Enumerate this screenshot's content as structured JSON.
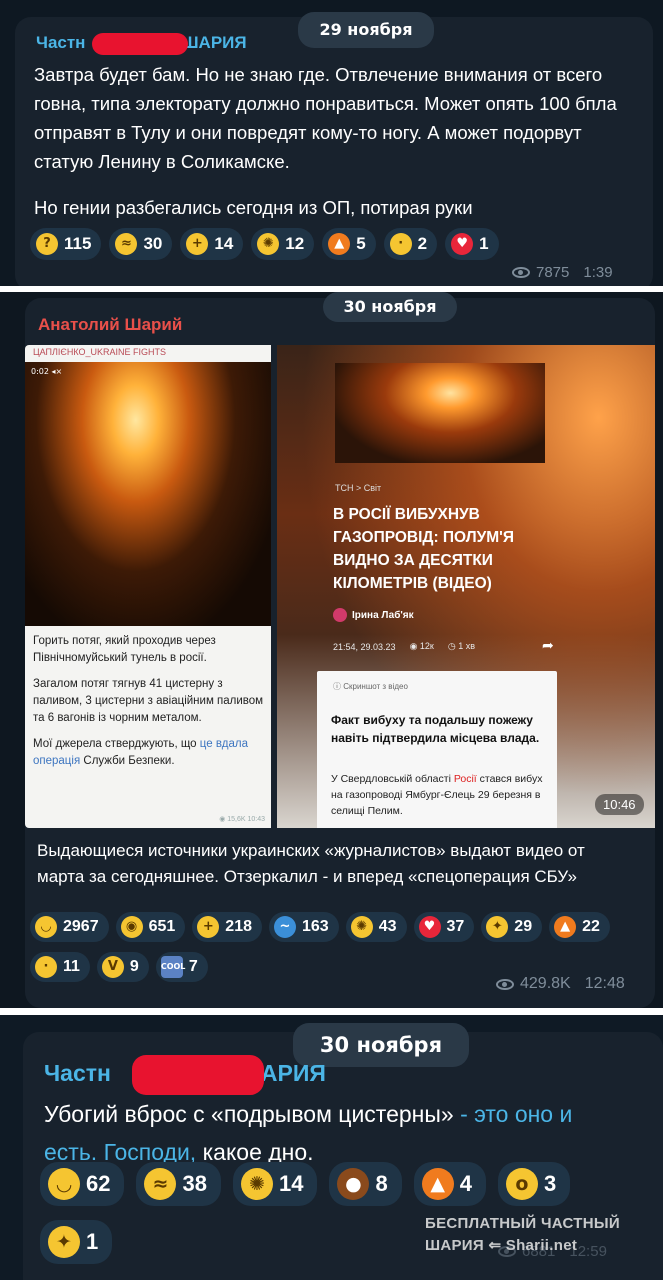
{
  "post1": {
    "date": "29 ноября",
    "sender_left": "Частн",
    "sender_right": "ШАРИЯ",
    "text_p1": "Завтра будет бам. Но не знаю где. Отвлечение внимания от всего говна, типа электорату должно понравиться. Может опять 100 бпла отправят в Тулу и они повредят кому-то ногу. А может подорвут статую Ленину в Соликамске.",
    "text_p2": "Но гении разбегались сегодня из ОП, потирая руки",
    "reactions": [
      {
        "emoji": "thinking-face",
        "glyph": "?",
        "count": "115"
      },
      {
        "emoji": "rolling-laughing",
        "glyph": "≈",
        "count": "30"
      },
      {
        "emoji": "thumbs-up",
        "glyph": "+",
        "count": "14"
      },
      {
        "emoji": "exploding-head",
        "glyph": "✺",
        "count": "12"
      },
      {
        "emoji": "fire",
        "glyph": "▲",
        "count": "5"
      },
      {
        "emoji": "crying-face",
        "glyph": "·",
        "count": "2"
      },
      {
        "emoji": "red-heart",
        "glyph": "♥",
        "count": "1"
      }
    ],
    "views": "7875",
    "time": "1:39"
  },
  "post2": {
    "date": "30 ноября",
    "sender": "Анатолий Шарий",
    "left_image": {
      "source": "ЦАПЛІЄНКО_UKRAINE FIGHTS",
      "video_time": "0:02 ◂×",
      "caption_p1": "Горить потяг, який проходив через Північномуйський тунель в росії.",
      "caption_p2": "Загалом потяг тягнув 41 цистерну з паливом, 3 цистерни з авіаційним паливом та 6 вагонів із чорним металом.",
      "caption_p3_a": "Мої джерела стверджують, що ",
      "caption_p3_link": "це вдала операція",
      "caption_p3_b": " Служби Безпеки.",
      "stamp": "◉ 15,6K 10:43"
    },
    "right_image": {
      "crumb": "ТСН  >  Світ",
      "headline": "В РОСІЇ ВИБУХНУВ ГАЗОПРОВІД: ПОЛУМ'Я ВИДНО ЗА ДЕСЯТКИ КІЛОМЕТРІВ (ВІДЕО)",
      "author": "Ірина Лаб'як",
      "date": "21:54, 29.03.23",
      "views": "◉ 12к",
      "read": "◷ 1 хв",
      "note": "ⓘ  Скриншот з відео",
      "fact": "Факт вибуху та подальшу пожежу навіть підтвердила місцева влада.",
      "body_a": "У Свердловській області ",
      "body_red": "Росії",
      "body_b": " стався вибух на газопроводі Ямбург-Єлець 29 березня в селищі Пелим.",
      "duration": "10:46"
    },
    "text": "Выдающиеся источники украинских «журналистов» выдают видео от марта за сегодняшнее. Отзеркалил - и вперед «спецоперация СБУ»",
    "reactions": [
      {
        "emoji": "grinning-face",
        "glyph": "◡",
        "count": "2967"
      },
      {
        "emoji": "see-no-evil-monkey",
        "glyph": "◉",
        "count": "651"
      },
      {
        "emoji": "thumbs-up",
        "glyph": "+",
        "count": "218"
      },
      {
        "emoji": "whale",
        "glyph": "~",
        "count": "163"
      },
      {
        "emoji": "exploding-head",
        "glyph": "✺",
        "count": "43"
      },
      {
        "emoji": "red-heart",
        "glyph": "♥",
        "count": "37"
      },
      {
        "emoji": "clapping-hands",
        "glyph": "✦",
        "count": "29"
      },
      {
        "emoji": "fire",
        "glyph": "▲",
        "count": "22"
      },
      {
        "emoji": "crying-face",
        "glyph": "·",
        "count": "11"
      },
      {
        "emoji": "victory-hand",
        "glyph": "V",
        "count": "9"
      },
      {
        "emoji": "cool-button",
        "glyph": "COOL",
        "count": "7"
      }
    ],
    "views": "429.8K",
    "time": "12:48"
  },
  "post3": {
    "date": "30 ноября",
    "sender_left": "Частн",
    "sender_right": "АРИЯ",
    "text_a": "Убогий вброс с «подрывом цистерны» ",
    "text_link": "- это оно и есть. Господи,",
    "text_b": " какое дно.",
    "reactions": [
      {
        "emoji": "grinning-face",
        "glyph": "◡",
        "count": "62"
      },
      {
        "emoji": "rolling-laughing",
        "glyph": "≈",
        "count": "38"
      },
      {
        "emoji": "exploding-head",
        "glyph": "✺",
        "count": "14"
      },
      {
        "emoji": "pile-of-poo",
        "glyph": "●",
        "count": "8"
      },
      {
        "emoji": "fire",
        "glyph": "▲",
        "count": "4"
      },
      {
        "emoji": "yawning-face",
        "glyph": "o",
        "count": "3"
      },
      {
        "emoji": "clapping-hands",
        "glyph": "✦",
        "count": "1"
      }
    ],
    "views": "6881",
    "time": "12:59"
  },
  "watermark": {
    "line1": "БЕСПЛАТНЫЙ  ЧАСТНЫЙ",
    "line2": "ШАРИЯ  ⇐  Sharii.net"
  },
  "colors": {
    "accent_blue": "#4bb5e6",
    "sender_red": "#e8504a",
    "redaction": "#e8132f",
    "bubble": "#18222d",
    "reaction_bg": "#1f3446"
  }
}
